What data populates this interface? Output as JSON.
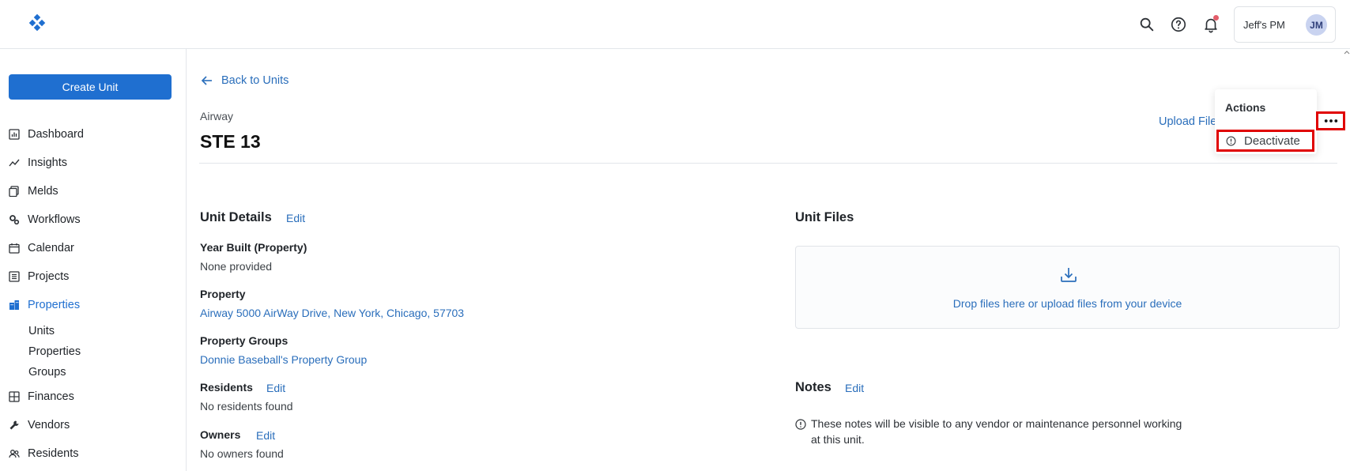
{
  "topbar": {
    "account_name": "Jeff's PM",
    "avatar_initials": "JM"
  },
  "sidebar": {
    "create_label": "Create Unit",
    "items": [
      {
        "label": "Dashboard",
        "icon": "dashboard-icon"
      },
      {
        "label": "Insights",
        "icon": "insights-icon"
      },
      {
        "label": "Melds",
        "icon": "melds-icon"
      },
      {
        "label": "Workflows",
        "icon": "workflows-icon"
      },
      {
        "label": "Calendar",
        "icon": "calendar-icon"
      },
      {
        "label": "Projects",
        "icon": "projects-icon"
      },
      {
        "label": "Properties",
        "icon": "properties-icon"
      },
      {
        "label": "Finances",
        "icon": "finances-icon"
      },
      {
        "label": "Vendors",
        "icon": "vendors-icon"
      },
      {
        "label": "Residents",
        "icon": "residents-icon"
      }
    ],
    "sub_items": [
      "Units",
      "Properties",
      "Groups"
    ]
  },
  "main": {
    "back_label": "Back to Units",
    "property_name": "Airway",
    "unit_title": "STE 13",
    "upload_files_label": "Upload File",
    "unit_details": {
      "title": "Unit Details",
      "edit_label": "Edit",
      "year_built_label": "Year Built (Property)",
      "year_built_value": "None provided",
      "property_label": "Property",
      "property_value": "Airway 5000 AirWay Drive, New York, Chicago, 57703",
      "property_groups_label": "Property Groups",
      "property_groups_value": "Donnie Baseball's Property Group",
      "residents_label": "Residents",
      "residents_edit": "Edit",
      "residents_value": "No residents found",
      "owners_label": "Owners",
      "owners_edit": "Edit",
      "owners_value": "No owners found"
    },
    "unit_files": {
      "title": "Unit Files",
      "drop_text": "Drop files here or upload files from your device"
    },
    "notes": {
      "title": "Notes",
      "edit_label": "Edit",
      "info_text": "These notes will be visible to any vendor or maintenance personnel working at this unit."
    }
  },
  "actions_menu": {
    "title": "Actions",
    "deactivate_label": "Deactivate"
  },
  "colors": {
    "primary": "#1f6fd0",
    "link": "#2a6ebb",
    "highlight": "#e00000"
  }
}
